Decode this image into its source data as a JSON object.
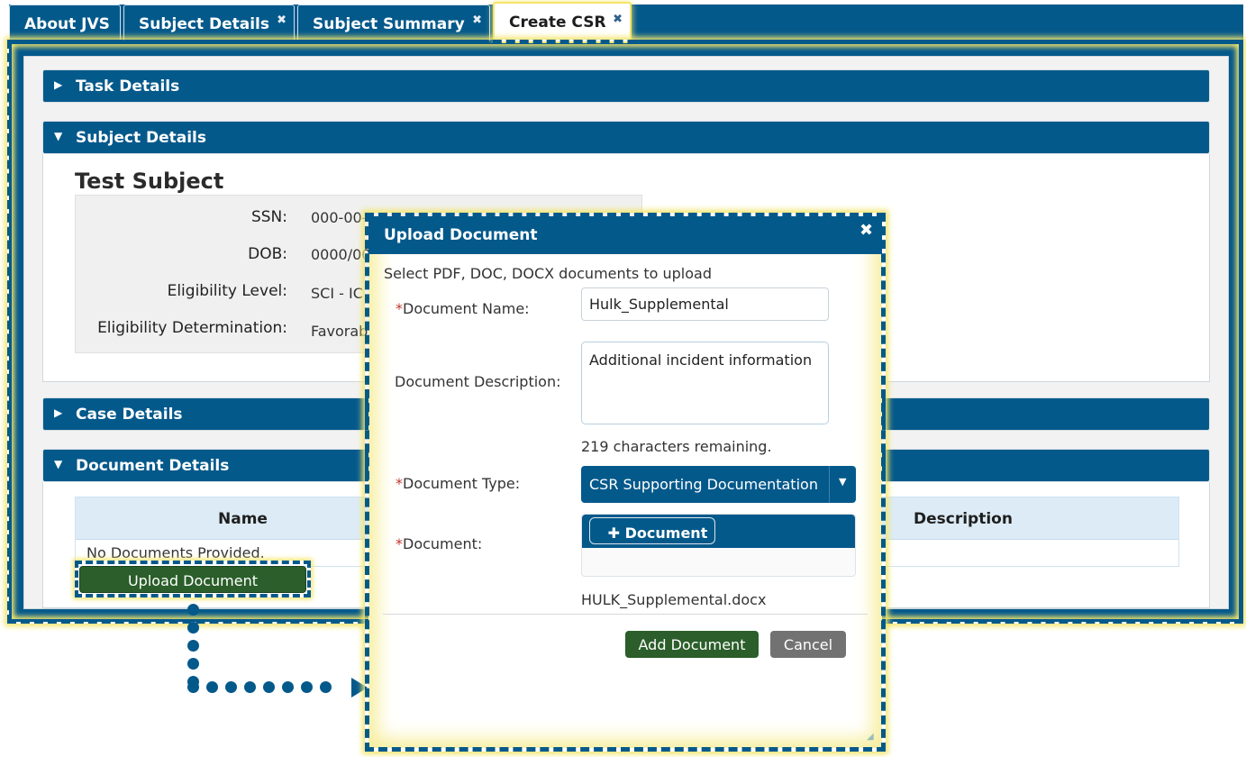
{
  "tabs": [
    {
      "label": "About JVS",
      "closable": false
    },
    {
      "label": "Subject Details",
      "closable": true
    },
    {
      "label": "Subject Summary",
      "closable": true
    },
    {
      "label": "Create CSR",
      "closable": true,
      "active": true
    }
  ],
  "close_glyph": "✖",
  "panels": {
    "task_details": {
      "title": "Task Details",
      "expanded": false
    },
    "subject_details": {
      "title": "Subject Details",
      "expanded": true
    },
    "case_details": {
      "title": "Case Details",
      "expanded": false
    },
    "document_details": {
      "title": "Document Details",
      "expanded": true
    }
  },
  "subject": {
    "name": "Test Subject",
    "fields": [
      {
        "label": "SSN:",
        "value": "000-00-"
      },
      {
        "label": "DOB:",
        "value": "0000/00"
      },
      {
        "label": "Eligibility Level:",
        "value": "SCI - IC"
      },
      {
        "label": "Eligibility Determination:",
        "value": "Favorab"
      }
    ]
  },
  "documents_table": {
    "columns": [
      "Name",
      "Description"
    ],
    "empty_text": "No Documents Provided."
  },
  "upload_button_label": "Upload Document",
  "modal": {
    "title": "Upload Document",
    "instructions": "Select PDF, DOC, DOCX documents to upload",
    "required_marker": "*",
    "document_name_label": "Document Name:",
    "document_name_value": "Hulk_Supplemental",
    "document_description_label": "Document Description:",
    "document_description_value": "Additional incident information",
    "chars_remaining": "219 characters remaining.",
    "document_type_label": "Document Type:",
    "document_type_value": "CSR Supporting Documentation",
    "document_label": "Document:",
    "add_file_button": "Document",
    "selected_file": "HULK_Supplemental.docx",
    "add_button": "Add Document",
    "cancel_button": "Cancel"
  },
  "colors": {
    "primary": "#04598b",
    "highlight": "#f3e56b",
    "success": "#2b5e2a",
    "neutral": "#727272",
    "required": "#c0392b"
  }
}
